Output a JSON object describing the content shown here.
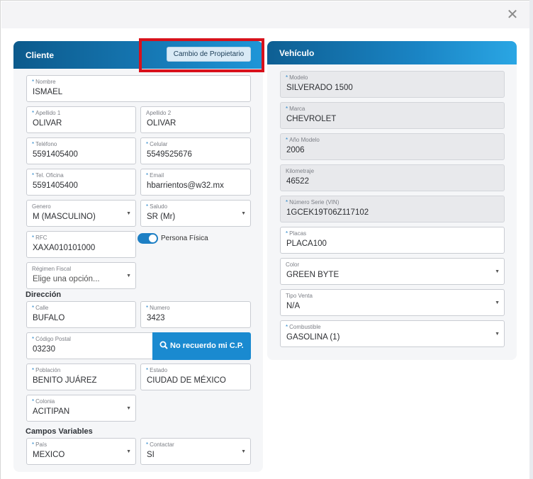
{
  "close_icon": "close-icon",
  "cliente": {
    "title": "Cliente",
    "cambio_button": "Cambio de Propietario",
    "nombre": {
      "label": "Nombre",
      "value": "ISMAEL"
    },
    "apellido1": {
      "label": "Apellido 1",
      "value": "OLIVAR"
    },
    "apellido2": {
      "label": "Apellido 2",
      "value": "OLIVAR"
    },
    "telefono": {
      "label": "Teléfono",
      "value": "5591405400"
    },
    "celular": {
      "label": "Celular",
      "value": "5549525676"
    },
    "tel_oficina": {
      "label": "Tel. Oficina",
      "value": "5591405400"
    },
    "email": {
      "label": "Email",
      "value": "hbarrientos@w32.mx"
    },
    "genero": {
      "label": "Genero",
      "value": "M (MASCULINO)"
    },
    "saludo": {
      "label": "Saludo",
      "value": "SR (Mr)"
    },
    "rfc": {
      "label": "RFC",
      "value": "XAXA010101000"
    },
    "persona_fisica": {
      "label": "Persona Física",
      "on": true
    },
    "regimen": {
      "label": "Régimen Fiscal",
      "placeholder": "Elige una opción..."
    },
    "direccion_title": "Dirección",
    "calle": {
      "label": "Calle",
      "value": "BUFALO"
    },
    "numero": {
      "label": "Numero",
      "value": "3423"
    },
    "codigo_postal": {
      "label": "Código Postal",
      "value": "03230"
    },
    "cp_button": "No recuerdo mi C.P.",
    "poblacion": {
      "label": "Población",
      "value": "BENITO JUÁREZ"
    },
    "estado": {
      "label": "Estado",
      "value": "CIUDAD DE MÉXICO"
    },
    "colonia": {
      "label": "Colonia",
      "value": "ACITIPAN"
    },
    "campos_title": "Campos Variables",
    "pais": {
      "label": "País",
      "value": "MEXICO"
    },
    "contactar": {
      "label": "Contactar",
      "value": "SI"
    }
  },
  "vehiculo": {
    "title": "Vehículo",
    "modelo": {
      "label": "Modelo",
      "value": "SILVERADO 1500"
    },
    "marca": {
      "label": "Marca",
      "value": "CHEVROLET"
    },
    "anio": {
      "label": "Año Modelo",
      "value": "2006"
    },
    "kilometraje": {
      "label": "Kilometraje",
      "value": "46522"
    },
    "serie": {
      "label": "Número Serie (VIN)",
      "value": "1GCEK19T06Z117102"
    },
    "placas": {
      "label": "Placas",
      "value": "PLACA100"
    },
    "color": {
      "label": "Color",
      "value": "GREEN BYTE"
    },
    "tipo_venta": {
      "label": "Tipo Venta",
      "value": "N/A"
    },
    "combustible": {
      "label": "Combustible",
      "value": "GASOLINA (1)"
    }
  },
  "colors": {
    "header": "#1678b4",
    "accent": "#1a8ad0",
    "highlight": "#d8111b"
  }
}
